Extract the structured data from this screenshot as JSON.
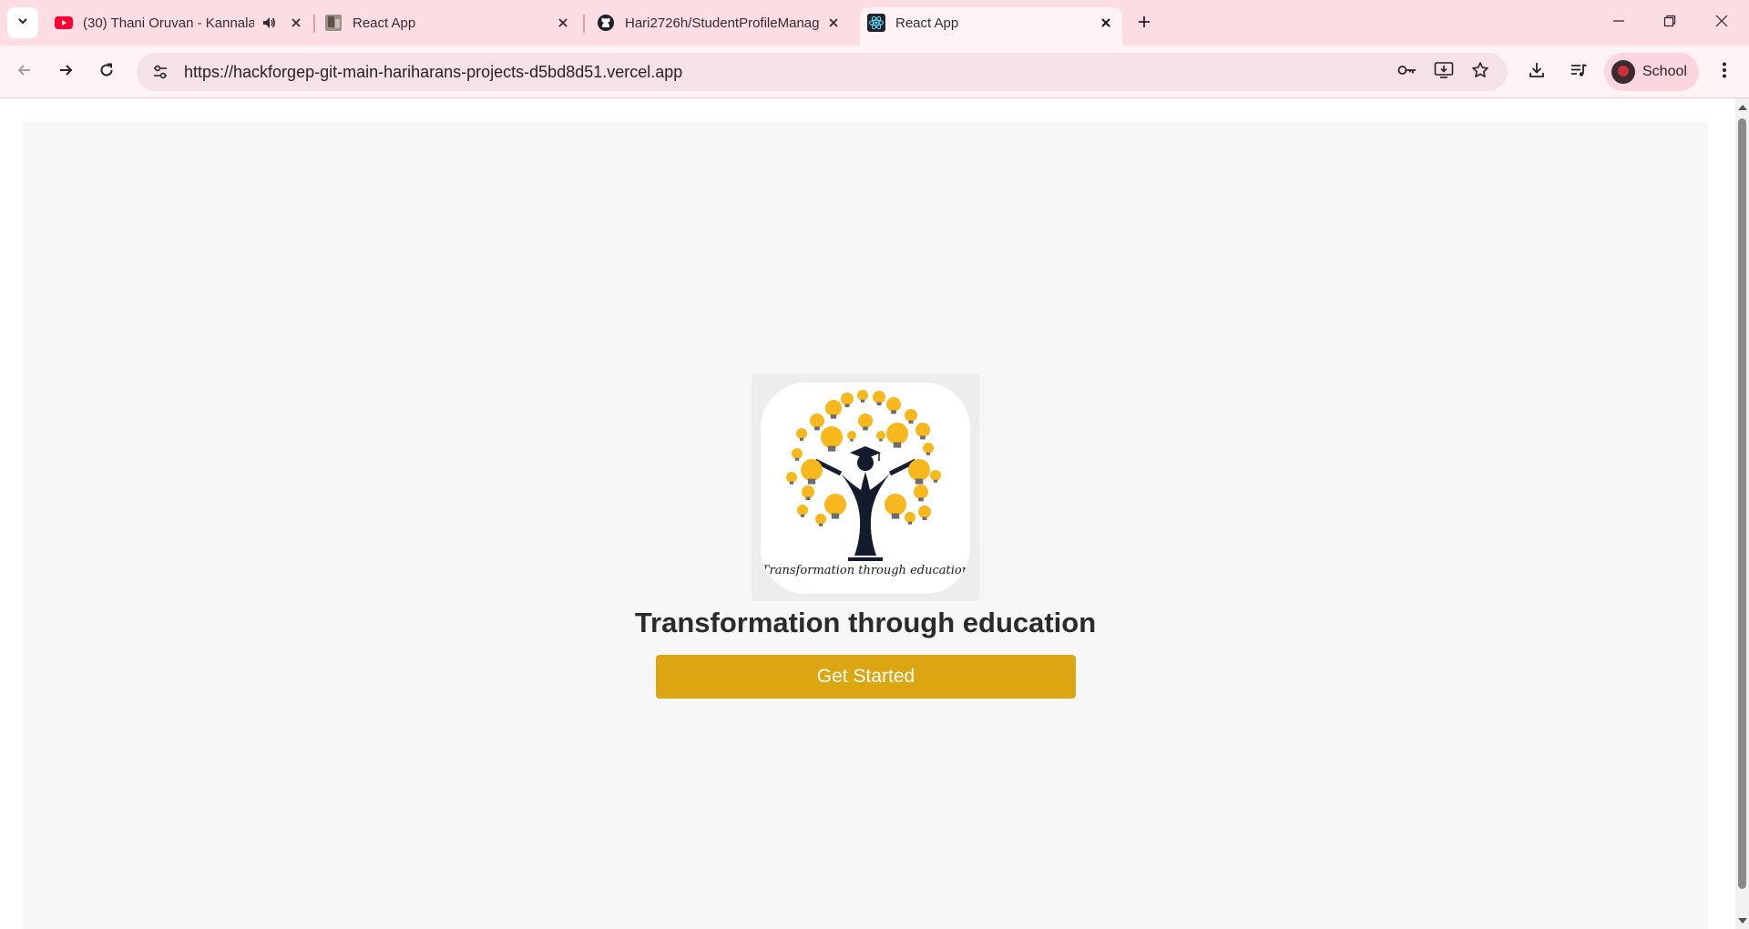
{
  "browser": {
    "tabs": [
      {
        "title": "(30) Thani Oruvan - Kannala",
        "favicon": "youtube-icon",
        "audio": true
      },
      {
        "title": "React App",
        "favicon": "image-thumbnail-icon"
      },
      {
        "title": "Hari2726h/StudentProfileManag",
        "favicon": "github-icon"
      },
      {
        "title": "React App",
        "favicon": "react-icon",
        "active": true
      }
    ],
    "url": "https://hackforgep-git-main-hariharans-projects-d5bd8d51.vercel.app",
    "profile_name": "School"
  },
  "page": {
    "logo_caption": "Transformation through education",
    "hero_title": "Transformation through education",
    "cta_label": "Get Started"
  },
  "colors": {
    "accent": "#dba611",
    "tabstrip": "#fcdde3",
    "toolbar": "#fff3f5",
    "bulb": "#f7b81e"
  }
}
